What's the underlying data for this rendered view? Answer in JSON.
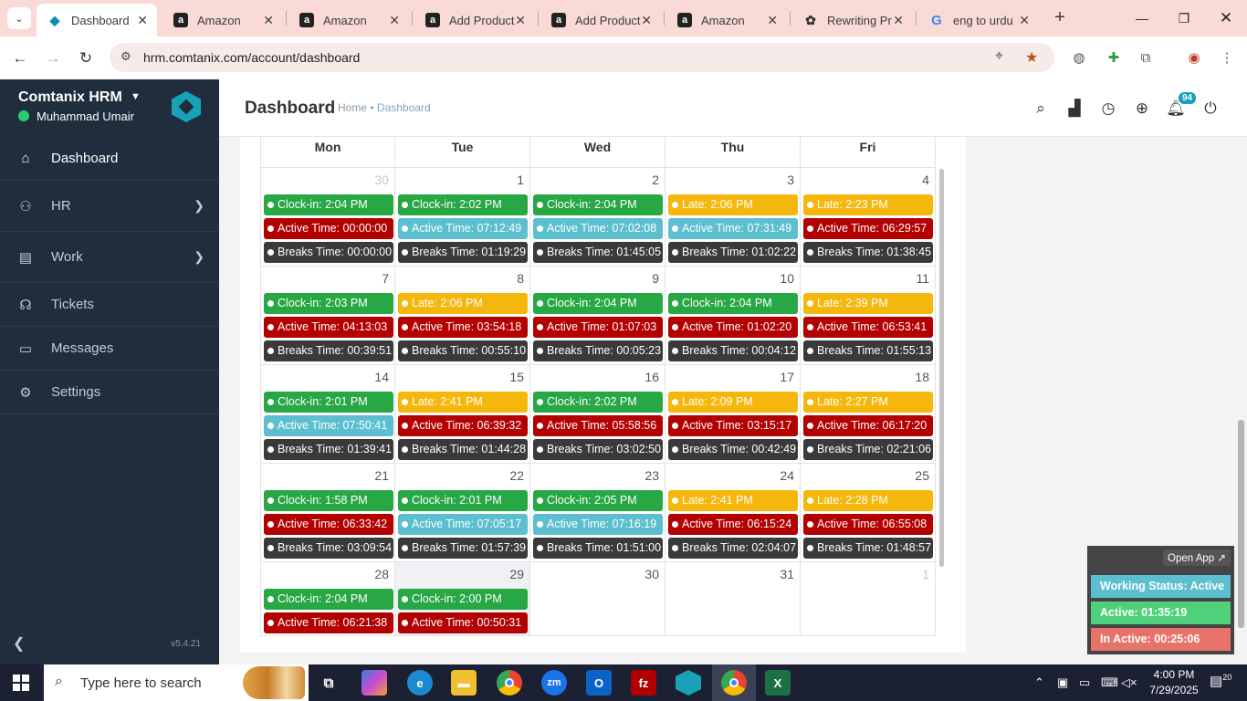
{
  "browser": {
    "tabs": [
      {
        "title": "Dashboard",
        "icon": "hrm-icon",
        "active": true
      },
      {
        "title": "Amazon",
        "icon": "amazon-icon"
      },
      {
        "title": "Amazon",
        "icon": "amazon-icon"
      },
      {
        "title": "Add Product",
        "icon": "amazon-icon"
      },
      {
        "title": "Add Product",
        "icon": "amazon-icon"
      },
      {
        "title": "Amazon",
        "icon": "amazon-icon"
      },
      {
        "title": "Rewriting Pr",
        "icon": "openai-icon"
      },
      {
        "title": "eng to urdu",
        "icon": "google-icon"
      }
    ],
    "url": "hrm.comtanix.com/account/dashboard"
  },
  "sidebar": {
    "brand": "Comtanix HRM",
    "user": "Muhammad Umair",
    "items": [
      {
        "label": "Dashboard",
        "icon": "home-icon",
        "active": true
      },
      {
        "label": "HR",
        "icon": "users-icon",
        "has_children": true
      },
      {
        "label": "Work",
        "icon": "briefcase-icon",
        "has_children": true
      },
      {
        "label": "Tickets",
        "icon": "headset-icon"
      },
      {
        "label": "Messages",
        "icon": "chat-icon"
      },
      {
        "label": "Settings",
        "icon": "gear-icon"
      }
    ],
    "version": "v5.4.21"
  },
  "header": {
    "title": "Dashboard",
    "breadcrumb_home": "Home",
    "breadcrumb_sep": "•",
    "breadcrumb_current": "Dashboard",
    "notification_count": "94"
  },
  "calendar": {
    "days": [
      "Mon",
      "Tue",
      "Wed",
      "Thu",
      "Fri"
    ],
    "weeks": [
      [
        {
          "date": "30",
          "muted": true,
          "events": [
            {
              "text": "Clock-in: 2:04 PM",
              "color": "green"
            },
            {
              "text": "Active Time: 00:00:00",
              "color": "red"
            },
            {
              "text": "Breaks Time: 00:00:00",
              "color": "dark"
            }
          ]
        },
        {
          "date": "1",
          "events": [
            {
              "text": "Clock-in: 2:02 PM",
              "color": "green"
            },
            {
              "text": "Active Time: 07:12:49",
              "color": "cyan"
            },
            {
              "text": "Breaks Time: 01:19:29",
              "color": "dark"
            }
          ]
        },
        {
          "date": "2",
          "events": [
            {
              "text": "Clock-in: 2:04 PM",
              "color": "green"
            },
            {
              "text": "Active Time: 07:02:08",
              "color": "cyan"
            },
            {
              "text": "Breaks Time: 01:45:05",
              "color": "dark"
            }
          ]
        },
        {
          "date": "3",
          "events": [
            {
              "text": "Late: 2:06 PM",
              "color": "yellow"
            },
            {
              "text": "Active Time: 07:31:49",
              "color": "cyan"
            },
            {
              "text": "Breaks Time: 01:02:22",
              "color": "dark"
            }
          ]
        },
        {
          "date": "4",
          "events": [
            {
              "text": "Late: 2:23 PM",
              "color": "yellow"
            },
            {
              "text": "Active Time: 06:29:57",
              "color": "red"
            },
            {
              "text": "Breaks Time: 01:38:45",
              "color": "dark"
            }
          ]
        }
      ],
      [
        {
          "date": "7",
          "events": [
            {
              "text": "Clock-in: 2:03 PM",
              "color": "green"
            },
            {
              "text": "Active Time: 04:13:03",
              "color": "red"
            },
            {
              "text": "Breaks Time: 00:39:51",
              "color": "dark"
            }
          ]
        },
        {
          "date": "8",
          "events": [
            {
              "text": "Late: 2:06 PM",
              "color": "yellow"
            },
            {
              "text": "Active Time: 03:54:18",
              "color": "red"
            },
            {
              "text": "Breaks Time: 00:55:10",
              "color": "dark"
            }
          ]
        },
        {
          "date": "9",
          "events": [
            {
              "text": "Clock-in: 2:04 PM",
              "color": "green"
            },
            {
              "text": "Active Time: 01:07:03",
              "color": "red"
            },
            {
              "text": "Breaks Time: 00:05:23",
              "color": "dark"
            }
          ]
        },
        {
          "date": "10",
          "events": [
            {
              "text": "Clock-in: 2:04 PM",
              "color": "green"
            },
            {
              "text": "Active Time: 01:02:20",
              "color": "red"
            },
            {
              "text": "Breaks Time: 00:04:12",
              "color": "dark"
            }
          ]
        },
        {
          "date": "11",
          "events": [
            {
              "text": "Late: 2:39 PM",
              "color": "yellow"
            },
            {
              "text": "Active Time: 06:53:41",
              "color": "red"
            },
            {
              "text": "Breaks Time: 01:55:13",
              "color": "dark"
            }
          ]
        }
      ],
      [
        {
          "date": "14",
          "events": [
            {
              "text": "Clock-in: 2:01 PM",
              "color": "green"
            },
            {
              "text": "Active Time: 07:50:41",
              "color": "cyan"
            },
            {
              "text": "Breaks Time: 01:39:41",
              "color": "dark"
            }
          ]
        },
        {
          "date": "15",
          "events": [
            {
              "text": "Late: 2:41 PM",
              "color": "yellow"
            },
            {
              "text": "Active Time: 06:39:32",
              "color": "red"
            },
            {
              "text": "Breaks Time: 01:44:28",
              "color": "dark"
            }
          ]
        },
        {
          "date": "16",
          "events": [
            {
              "text": "Clock-in: 2:02 PM",
              "color": "green"
            },
            {
              "text": "Active Time: 05:58:56",
              "color": "red"
            },
            {
              "text": "Breaks Time: 03:02:50",
              "color": "dark"
            }
          ]
        },
        {
          "date": "17",
          "events": [
            {
              "text": "Late: 2:09 PM",
              "color": "yellow"
            },
            {
              "text": "Active Time: 03:15:17",
              "color": "red"
            },
            {
              "text": "Breaks Time: 00:42:49",
              "color": "dark"
            }
          ]
        },
        {
          "date": "18",
          "events": [
            {
              "text": "Late: 2:27 PM",
              "color": "yellow"
            },
            {
              "text": "Active Time: 06:17:20",
              "color": "red"
            },
            {
              "text": "Breaks Time: 02:21:06",
              "color": "dark"
            }
          ]
        }
      ],
      [
        {
          "date": "21",
          "events": [
            {
              "text": "Clock-in: 1:58 PM",
              "color": "green"
            },
            {
              "text": "Active Time: 06:33:42",
              "color": "red"
            },
            {
              "text": "Breaks Time: 03:09:54",
              "color": "dark"
            }
          ]
        },
        {
          "date": "22",
          "events": [
            {
              "text": "Clock-in: 2:01 PM",
              "color": "green"
            },
            {
              "text": "Active Time: 07:05:17",
              "color": "cyan"
            },
            {
              "text": "Breaks Time: 01:57:39",
              "color": "dark"
            }
          ]
        },
        {
          "date": "23",
          "events": [
            {
              "text": "Clock-in: 2:05 PM",
              "color": "green"
            },
            {
              "text": "Active Time: 07:16:19",
              "color": "cyan"
            },
            {
              "text": "Breaks Time: 01:51:00",
              "color": "dark"
            }
          ]
        },
        {
          "date": "24",
          "events": [
            {
              "text": "Late: 2:41 PM",
              "color": "yellow"
            },
            {
              "text": "Active Time: 06:15:24",
              "color": "red"
            },
            {
              "text": "Breaks Time: 02:04:07",
              "color": "dark"
            }
          ]
        },
        {
          "date": "25",
          "events": [
            {
              "text": "Late: 2:28 PM",
              "color": "yellow"
            },
            {
              "text": "Active Time: 06:55:08",
              "color": "red"
            },
            {
              "text": "Breaks Time: 01:48:57",
              "color": "dark"
            }
          ]
        }
      ],
      [
        {
          "date": "28",
          "events": [
            {
              "text": "Clock-in: 2:04 PM",
              "color": "green"
            },
            {
              "text": "Active Time: 06:21:38",
              "color": "red"
            }
          ]
        },
        {
          "date": "29",
          "today": true,
          "events": [
            {
              "text": "Clock-in: 2:00 PM",
              "color": "green"
            },
            {
              "text": "Active Time: 00:50:31",
              "color": "red"
            }
          ]
        },
        {
          "date": "30",
          "events": []
        },
        {
          "date": "31",
          "events": []
        },
        {
          "date": "1",
          "muted": true,
          "events": []
        }
      ]
    ]
  },
  "status_widget": {
    "open_app": "Open App ↗",
    "working_status": "Working Status: Active",
    "active": "Active: 01:35:19",
    "inactive": "In Active: 00:25:06"
  },
  "taskbar": {
    "search_placeholder": "Type here to search",
    "time": "4:00 PM",
    "date": "7/29/2025",
    "notification_count": "20"
  },
  "colors": {
    "green": "#28a745",
    "red": "#b30000",
    "cyan": "#5bbfcf",
    "yellow": "#f6b70c",
    "dark": "#3a3a3a",
    "sidebar": "#1f2d3d",
    "accent": "#17a2b8"
  }
}
